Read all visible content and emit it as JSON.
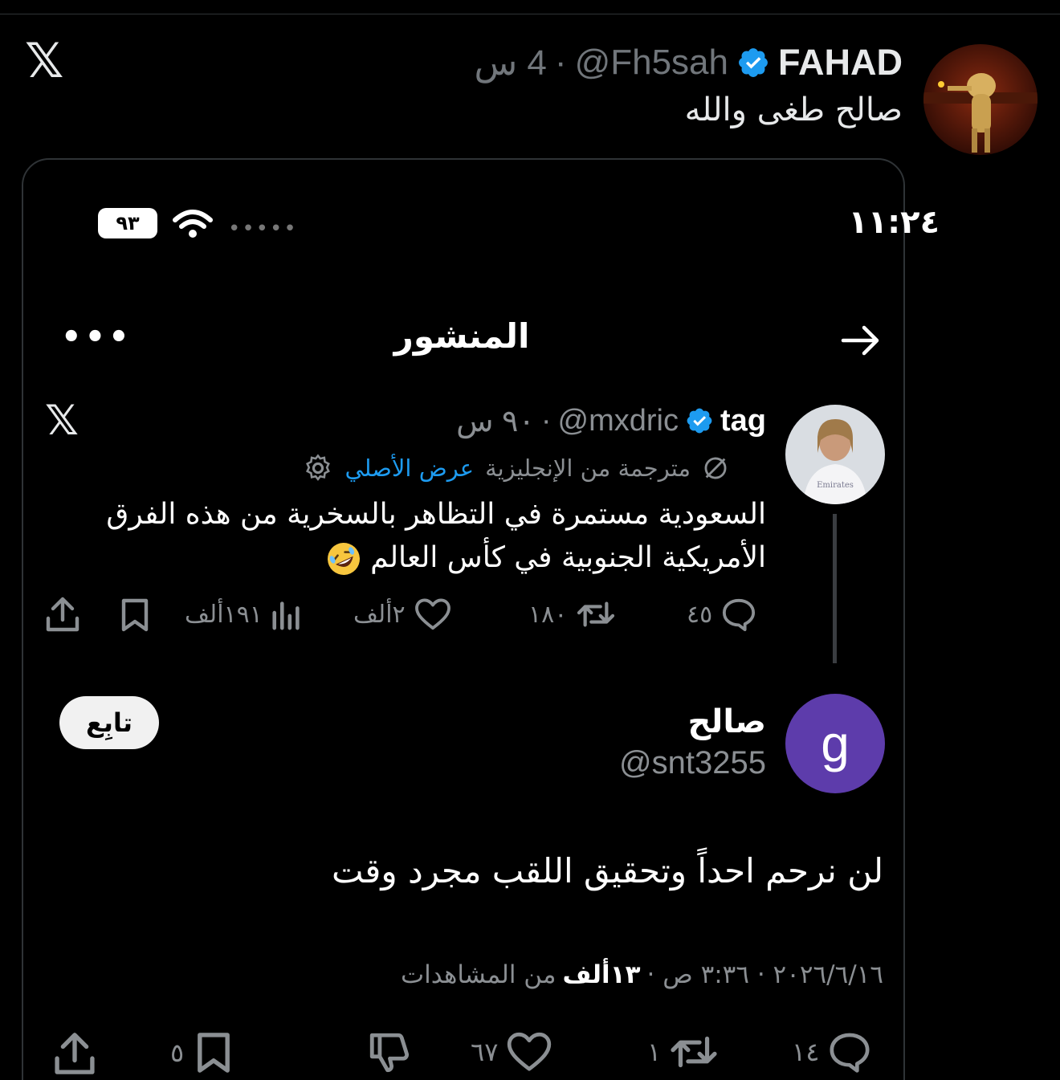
{
  "outer_tweet": {
    "author_name": "FAHAD",
    "handle": "@Fh5sah",
    "time": "4 س",
    "text": "صالح طغى والله"
  },
  "screenshot": {
    "status_bar": {
      "time": "١١:٢٤",
      "battery": "٩٣"
    },
    "nav": {
      "title": "المنشور"
    },
    "quoted_post": {
      "author_name": "tag",
      "handle": "@mxdric",
      "time": "٩٠ س",
      "translated_label": "مترجمة من الإنجليزية",
      "show_original": "عرض الأصلي",
      "text": "السعودية مستمرة في التظاهر بالسخرية من هذه الفرق الأمريكية الجنوبية في كأس العالم",
      "stats": {
        "replies": "٤٥",
        "reposts": "١٨٠",
        "likes": "٢ألف",
        "views": "١٩١ألف"
      }
    },
    "reply_post": {
      "avatar_letter": "g",
      "author_name": "صالح",
      "handle": "@snt3255",
      "follow_label": "تابِع",
      "text": "لن نرحم احداً وتحقيق اللقب مجرد وقت",
      "date_time": "٢٠٢٦/٦/١٦ · ٣:٣٦ ص ·",
      "views_count": "١٣ألف",
      "views_label": "من المشاهدات",
      "stats": {
        "replies": "١٤",
        "reposts": "١",
        "likes": "٦٧",
        "bookmarks": "٥"
      }
    }
  },
  "colors": {
    "accent": "#1d9bf0",
    "reply_avatar": "#5d3cab",
    "muted": "#71767b"
  }
}
